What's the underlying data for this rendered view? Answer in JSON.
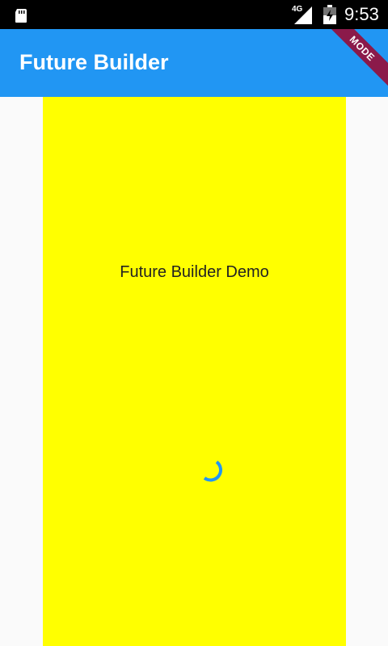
{
  "status_bar": {
    "network": "4G",
    "time": "9:53"
  },
  "app_bar": {
    "title": "Future Builder",
    "debug_banner": "MODE"
  },
  "body": {
    "text": "Future Builder Demo"
  },
  "colors": {
    "app_bar": "#2196f3",
    "box": "#ffff00",
    "spinner": "#2196f3"
  },
  "icons": [
    "sd-card-icon",
    "signal-icon",
    "battery-icon",
    "loading-spinner-icon"
  ]
}
